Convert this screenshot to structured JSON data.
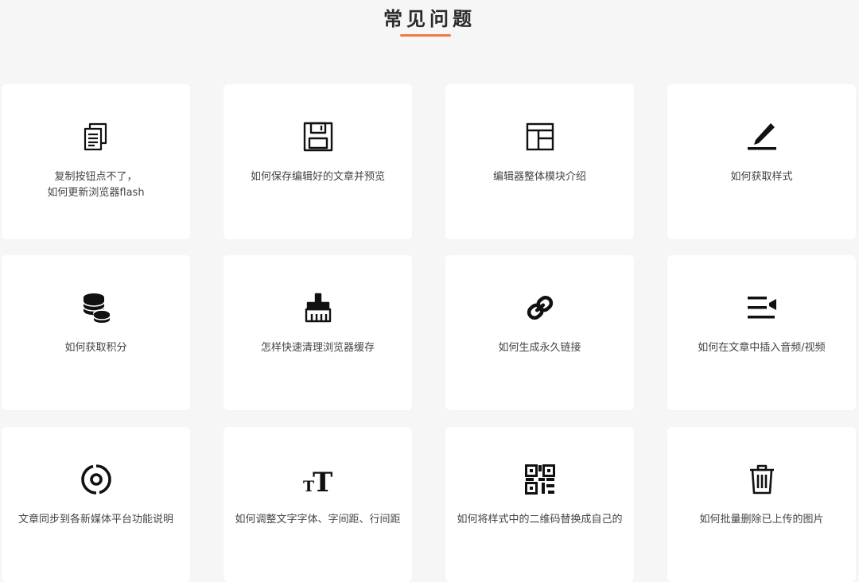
{
  "page": {
    "title": "常见问题"
  },
  "faq": [
    {
      "label": "复制按钮点不了，\n如何更新浏览器flash",
      "icon": "copy-documents-icon"
    },
    {
      "label": "如何保存编辑好的文章并预览",
      "icon": "floppy-save-icon"
    },
    {
      "label": "编辑器整体模块介绍",
      "icon": "layout-panel-icon"
    },
    {
      "label": "如何获取样式",
      "icon": "pen-edit-icon"
    },
    {
      "label": "如何获取积分",
      "icon": "coin-stack-icon"
    },
    {
      "label": "怎样快速清理浏览器缓存",
      "icon": "broom-clean-icon"
    },
    {
      "label": "如何生成永久链接",
      "icon": "link-icon"
    },
    {
      "label": "如何在文章中插入音频/视频",
      "icon": "video-list-icon"
    },
    {
      "label": "文章同步到各新媒体平台功能说明",
      "icon": "sync-circle-icon"
    },
    {
      "label": "如何调整文字字体、字间距、行间距",
      "icon": "text-size-icon"
    },
    {
      "label": "如何将样式中的二维码替换成自己的",
      "icon": "qr-code-icon"
    },
    {
      "label": "如何批量删除已上传的图片",
      "icon": "trash-icon"
    }
  ],
  "colors": {
    "accent": "#f07a3f",
    "background": "#f6f6f6",
    "card": "#ffffff",
    "icon": "#111111"
  }
}
